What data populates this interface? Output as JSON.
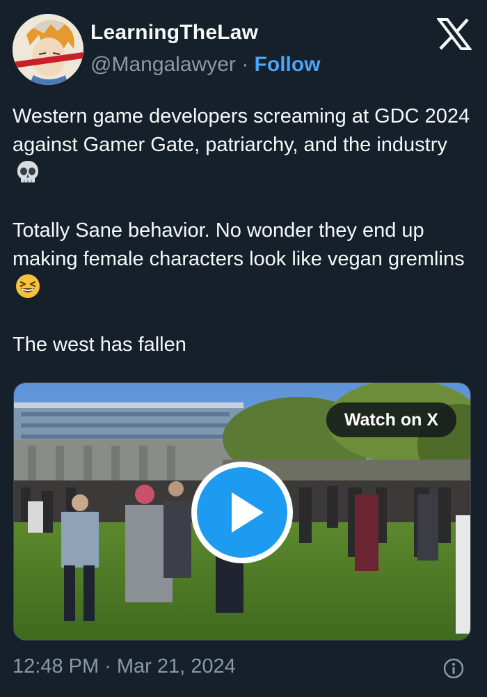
{
  "author": {
    "display_name": "LearningTheLaw",
    "handle": "@Mangalawyer",
    "separator": " · ",
    "follow_label": "Follow"
  },
  "tweet": {
    "line1": "Western game developers screaming at GDC 2024 against Gamer Gate, patriarchy, and the industry",
    "line2": "Totally Sane behavior. No wonder they end up making female characters look like vegan gremlins",
    "line3": "The west has fallen",
    "emoji1": "skull-emoji",
    "emoji2": "laughing-emoji"
  },
  "media": {
    "watch_label": "Watch on X"
  },
  "footer": {
    "timestamp": "12:48 PM · Mar 21, 2024"
  },
  "colors": {
    "background": "#15202b",
    "accent": "#1d9bf0",
    "follow": "#4da3f5",
    "muted": "#8b98a5"
  }
}
